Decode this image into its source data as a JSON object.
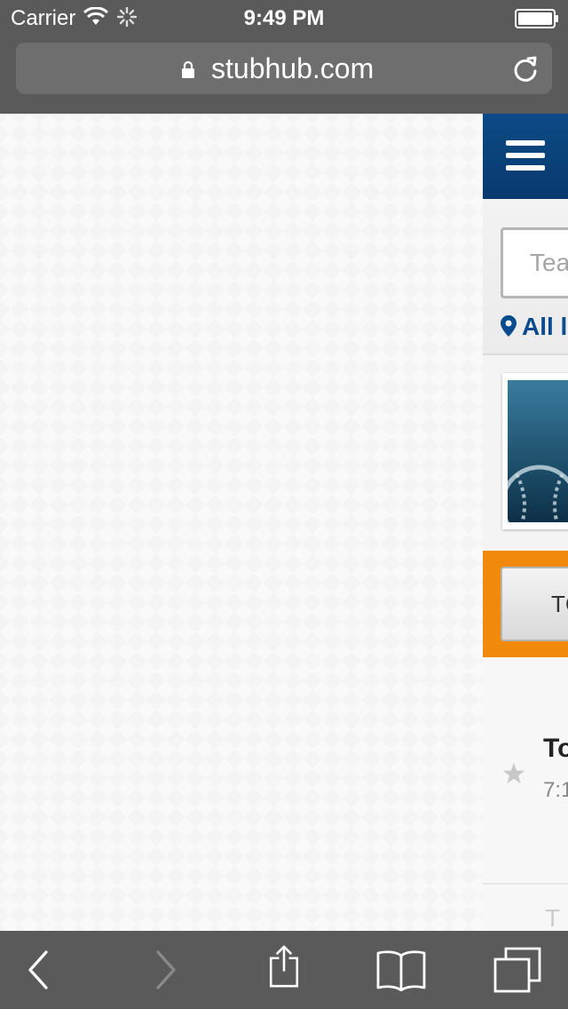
{
  "status_bar": {
    "carrier": "Carrier",
    "time": "9:49 PM"
  },
  "address_bar": {
    "url": "stubhub.com"
  },
  "site": {
    "search": {
      "placeholder": "Team"
    },
    "location_label": "All l",
    "top_button_label": "TC",
    "event": {
      "title": "To",
      "time": "7:1"
    },
    "faded_text": "T",
    "colors": {
      "header": "#0d4a86",
      "accent_orange": "#f18a0c",
      "link": "#0a4a8f"
    }
  },
  "icons": {
    "status": [
      "wifi-icon",
      "activity-spinner-icon",
      "battery-icon"
    ],
    "address": [
      "lock-icon",
      "reload-icon"
    ],
    "site": [
      "menu-icon",
      "location-pin-icon",
      "baseball-icon",
      "star-icon"
    ],
    "toolbar": [
      "back-icon",
      "forward-icon",
      "share-icon",
      "bookmarks-icon",
      "tabs-icon"
    ]
  }
}
